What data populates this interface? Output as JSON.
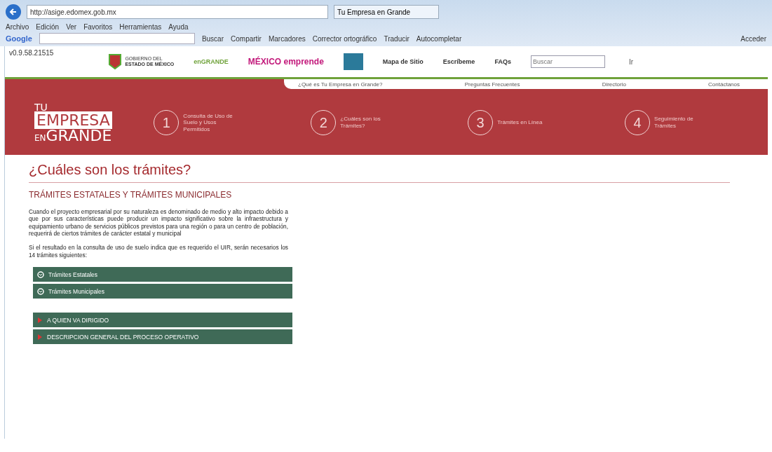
{
  "browser": {
    "address": "http://asige.edomex.gob.mx",
    "tab_title": "Tu Empresa en Grande",
    "menu": [
      "Archivo",
      "Edición",
      "Ver",
      "Favoritos",
      "Herramientas",
      "Ayuda"
    ],
    "toolbar": {
      "brand": "Google",
      "items": [
        "Buscar",
        "Compartir",
        "Marcadores",
        "Corrector ortográfico",
        "Traducir",
        "Autocompletar"
      ],
      "sign_in": "Acceder"
    }
  },
  "header": {
    "version": "v0.9.58.21515",
    "gov_line1": "GOBIERNO DEL",
    "gov_line2": "ESTADO DE MÉXICO",
    "engrande": "enGRANDE",
    "emprende": "MÉXICO emprende",
    "links": [
      "Mapa de Sitio",
      "Escríbeme",
      "FAQs"
    ],
    "search": {
      "placeholder": "Buscar"
    },
    "search_button": "Ir"
  },
  "nav": [
    "¿Qué es Tu Empresa en Grande?",
    "Preguntas Frecuentes",
    "Directorio",
    "Contáctanos"
  ],
  "banner": {
    "logo_top": "TU",
    "logo_box": "EMPRESA",
    "logo_small": "EN",
    "logo_bottom": "GRANDE",
    "steps": [
      {
        "number": "1",
        "label": "Consulta de Uso de Suelo y Usos Permitidos"
      },
      {
        "number": "2",
        "label": "¿Cuáles son los Trámites?"
      },
      {
        "number": "3",
        "label": "Trámites en Línea"
      },
      {
        "number": "4",
        "label": "Seguimiento de Trámites"
      }
    ]
  },
  "content": {
    "title": "¿Cuáles son los trámites?",
    "heading": "TRÁMITES ESTATALES Y TRÁMITES MUNICIPALES",
    "paragraphs": [
      "Cuando el proyecto empresarial por su naturaleza es denominado de medio y alto impacto debido a que por sus características puede producir un impacto significativo sobre la infraestructura y equipamiento urbano de servicios públicos previstos para una región o para un centro de población, requerirá de ciertos trámites de carácter estatal y municipal",
      "Si el resultado en la consulta de uso de suelo indica que es requerido el UIR, serán necesarios los 14 trámites siguientes:"
    ],
    "groups": [
      [
        {
          "kind": "circle",
          "label": "Trámites Estatales"
        },
        {
          "kind": "circle",
          "label": "Trámites Municipales"
        }
      ],
      [
        {
          "kind": "arrow",
          "label": "A QUIEN VA DIRIGIDO"
        },
        {
          "kind": "arrow",
          "label": "DESCRIPCION GENERAL DEL PROCESO OPERATIVO"
        }
      ]
    ]
  }
}
